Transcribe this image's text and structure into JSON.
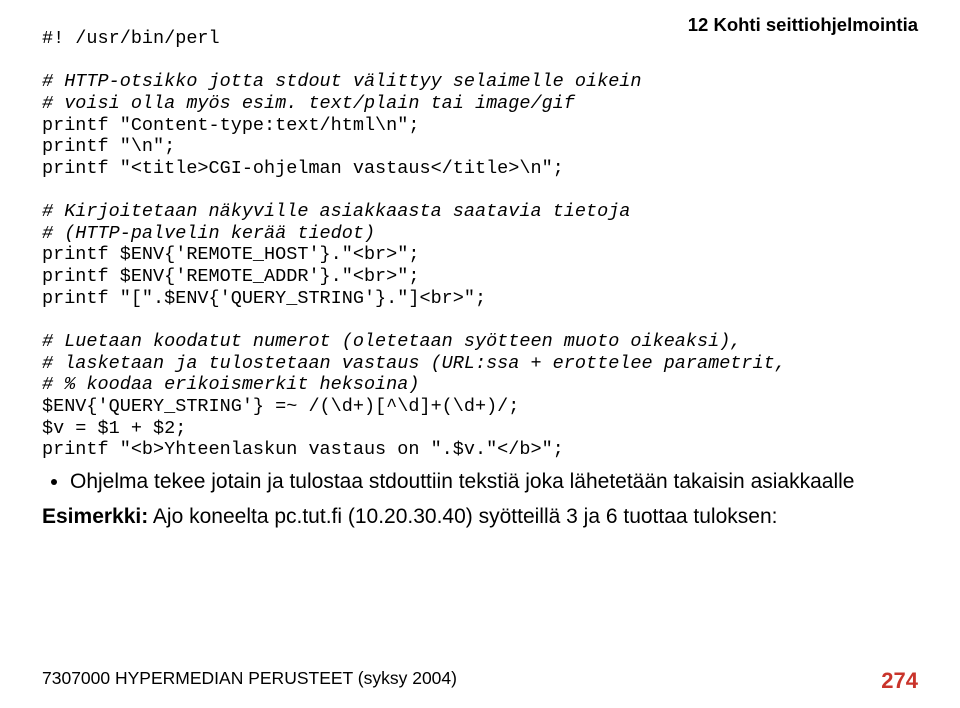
{
  "header": {
    "chapter": "12 Kohti seittiohjelmointia"
  },
  "code": {
    "shebang": "#! /usr/bin/perl",
    "c1": "# HTTP-otsikko jotta stdout välittyy selaimelle oikein",
    "c2": "# voisi olla myös esim. text/plain tai image/gif",
    "p1": "printf \"Content-type:text/html\\n\";",
    "p2": "printf \"\\n\";",
    "p3": "printf \"<title>CGI-ohjelman vastaus</title>\\n\";",
    "c3": "# Kirjoitetaan näkyville asiakkaasta saatavia tietoja",
    "c4": "# (HTTP-palvelin kerää tiedot)",
    "p4": "printf $ENV{'REMOTE_HOST'}.\"<br>\";",
    "p5": "printf $ENV{'REMOTE_ADDR'}.\"<br>\";",
    "p6": "printf \"[\".$ENV{'QUERY_STRING'}.\"]<br>\";",
    "c5": "# Luetaan koodatut numerot (oletetaan syötteen muoto oikeaksi),",
    "c6": "# lasketaan ja tulostetaan vastaus (URL:ssa + erottelee parametrit,",
    "c7": "# % koodaa erikoismerkit heksoina)",
    "p7": "$ENV{'QUERY_STRING'} =~ /(\\d+)[^\\d]+(\\d+)/;",
    "p8": "$v = $1 + $2;",
    "p9": "printf \"<b>Yhteenlaskun vastaus on \".$v.\"</b>\";"
  },
  "bullets": [
    "Ohjelma tekee jotain ja tulostaa stdouttiin tekstiä joka lähetetään takaisin asiakkaalle"
  ],
  "example": {
    "label": "Esimerkki:",
    "text": " Ajo koneelta pc.tut.fi (10.20.30.40) syötteillä 3 ja 6 tuottaa tuloksen:"
  },
  "footer": {
    "left": "7307000 HYPERMEDIAN PERUSTEET (syksy 2004)",
    "page": "274"
  }
}
